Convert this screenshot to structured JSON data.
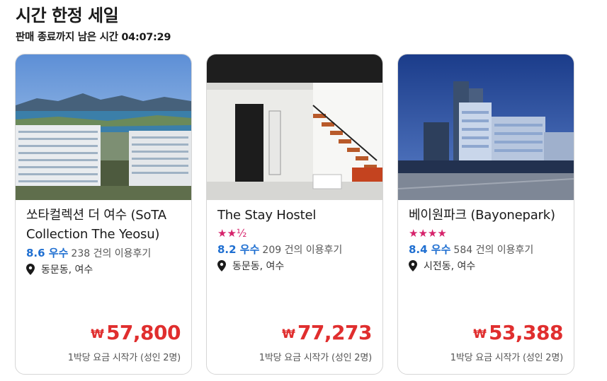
{
  "header": {
    "title": "시간 한정 세일",
    "countdown": "판매 종료까지 남은 시간 04:07:29"
  },
  "colors": {
    "accent": "#1f6fd1",
    "price": "#e02e2e",
    "stars": "#d6236b"
  },
  "icons": {
    "location": "location-pin-icon",
    "star": "star-icon",
    "currency": "won-icon"
  },
  "cards": [
    {
      "name": "쏘타컬렉션 더 여수 (SoTA Collection The Yeosu)",
      "stars": "",
      "score": "8.6 우수",
      "reviews": "238 건의 이용후기",
      "location": "동문동, 여수",
      "currency": "₩",
      "price": "57,800",
      "price_note": "1박당 요금 시작가 (성인 2명)"
    },
    {
      "name": "The Stay Hostel",
      "stars": "★★½",
      "score": "8.2 우수",
      "reviews": "209 건의 이용후기",
      "location": "동문동, 여수",
      "currency": "₩",
      "price": "77,273",
      "price_note": "1박당 요금 시작가 (성인 2명)"
    },
    {
      "name": "베이원파크 (Bayonepark)",
      "stars": "★★★★",
      "score": "8.4 우수",
      "reviews": "584 건의 이용후기",
      "location": "시전동, 여수",
      "currency": "₩",
      "price": "53,388",
      "price_note": "1박당 요금 시작가 (성인 2명)"
    }
  ]
}
